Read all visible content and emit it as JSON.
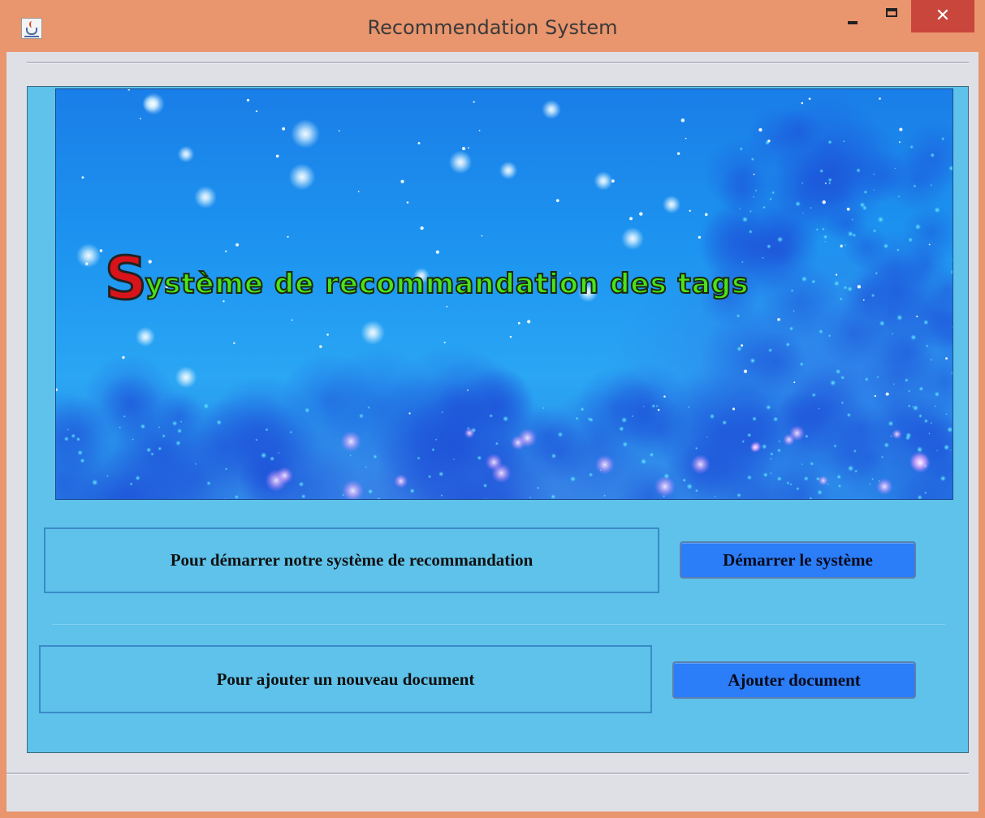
{
  "window": {
    "title": "Recommendation System",
    "app_icon": "java-cup-icon",
    "controls": {
      "minimize": "minimize-icon",
      "maximize": "maximize-icon",
      "close_label": "✕"
    }
  },
  "banner": {
    "title_initial": "S",
    "title_rest": "ystème de recommandation des tags"
  },
  "rows": [
    {
      "label": "Pour démarrer notre système de recommandation",
      "button_label": "Démarrer le système"
    },
    {
      "label": "Pour ajouter un nouveau document",
      "button_label": "Ajouter document"
    }
  ],
  "colors": {
    "titlebar": "#e9956d",
    "panel": "#5ec2ea",
    "button": "#2b7df8",
    "close": "#c9463d",
    "banner_title": "#4be21a",
    "banner_initial": "#d8141a"
  }
}
